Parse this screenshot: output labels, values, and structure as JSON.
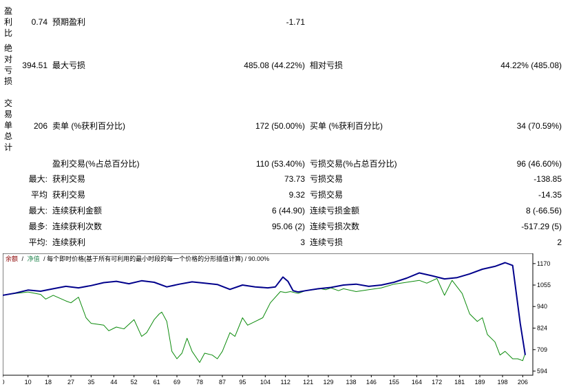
{
  "stats": {
    "row1": {
      "label": "盈利比",
      "value": "0.74",
      "c1_label": "预期盈利",
      "c1_value": "-1.71"
    },
    "row2": {
      "label": "绝对亏损",
      "value": "394.51",
      "c1_label": "最大亏损",
      "c1_value": "485.08 (44.22%)",
      "c2_label": "相对亏损",
      "c2_value": "44.22% (485.08)"
    },
    "row3": {
      "label": "交易单总计",
      "value": "206",
      "c1_label": "卖单 (%获利百分比)",
      "c1_value": "172 (50.00%)",
      "c2_label": "买单 (%获利百分比)",
      "c2_value": "34 (70.59%)"
    },
    "row4": {
      "c1_label": "盈利交易(%占总百分比)",
      "c1_value": "110 (53.40%)",
      "c2_label": "亏损交易(%占总百分比)",
      "c2_value": "96 (46.60%)"
    },
    "row5": {
      "prefix": "最大:",
      "c1_label": "获利交易",
      "c1_value": "73.73",
      "c2_label": "亏损交易",
      "c2_value": "-138.85"
    },
    "row6": {
      "prefix": "平均",
      "c1_label": "获利交易",
      "c1_value": "9.32",
      "c2_label": "亏损交易",
      "c2_value": "-14.35"
    },
    "row7": {
      "prefix": "最大:",
      "c1_label": "连续获利金额",
      "c1_value": "6 (44.90)",
      "c2_label": "连续亏损金额",
      "c2_value": "8 (-66.56)"
    },
    "row8": {
      "prefix": "最多:",
      "c1_label": "连续获利次数",
      "c1_value": "95.06 (2)",
      "c2_label": "连续亏损次数",
      "c2_value": "-517.29 (5)"
    },
    "row9": {
      "prefix": "平均:",
      "c1_label": "连续获利",
      "c1_value": "3",
      "c2_label": "连续亏损",
      "c2_value": "2"
    }
  },
  "chart_legend": {
    "balance": "余额",
    "sep1": "/",
    "equity": "净值",
    "rest": "/ 每个即时价格(基于所有可利用的最小时段的每一个价格的分形插值计算) / 90.00%"
  },
  "colors": {
    "balance": "#00008b",
    "equity": "#0a8a0a",
    "legend_balance": "#8b0000",
    "legend_equity": "#2e8b57"
  },
  "chart_data": {
    "type": "line",
    "x_ticks": [
      "0",
      "10",
      "18",
      "27",
      "35",
      "44",
      "52",
      "61",
      "69",
      "78",
      "87",
      "95",
      "104",
      "112",
      "121",
      "129",
      "138",
      "146",
      "155",
      "164",
      "172",
      "181",
      "189",
      "198",
      "206"
    ],
    "y_ticks": [
      "1170",
      "1055",
      "940",
      "824",
      "709",
      "594"
    ],
    "ylim": [
      594,
      1210
    ],
    "xlim": [
      0,
      210
    ],
    "series": [
      {
        "key": "balance",
        "x": [
          0,
          5,
          10,
          15,
          20,
          25,
          30,
          35,
          40,
          45,
          50,
          55,
          60,
          65,
          70,
          75,
          80,
          85,
          90,
          95,
          100,
          105,
          108,
          111,
          113,
          115,
          117,
          120,
          125,
          130,
          135,
          140,
          145,
          150,
          155,
          160,
          165,
          170,
          175,
          180,
          185,
          190,
          195,
          199,
          202,
          205,
          207
        ],
        "y": [
          1000,
          1012,
          1028,
          1022,
          1035,
          1048,
          1040,
          1052,
          1068,
          1075,
          1062,
          1078,
          1070,
          1045,
          1060,
          1072,
          1065,
          1058,
          1032,
          1055,
          1045,
          1040,
          1045,
          1098,
          1075,
          1025,
          1018,
          1025,
          1035,
          1042,
          1055,
          1060,
          1048,
          1055,
          1070,
          1092,
          1120,
          1105,
          1088,
          1095,
          1115,
          1140,
          1155,
          1175,
          1160,
          850,
          680
        ]
      },
      {
        "key": "equity",
        "x": [
          0,
          5,
          10,
          15,
          17,
          20,
          25,
          27,
          30,
          33,
          35,
          40,
          42,
          45,
          48,
          52,
          55,
          57,
          60,
          62,
          63,
          65,
          67,
          69,
          71,
          73,
          75,
          78,
          80,
          83,
          85,
          87,
          90,
          92,
          95,
          97,
          100,
          103,
          106,
          110,
          112,
          114,
          117,
          120,
          123,
          126,
          128,
          130,
          133,
          135,
          140,
          145,
          150,
          155,
          160,
          165,
          168,
          172,
          175,
          178,
          182,
          185,
          188,
          190,
          192,
          195,
          197,
          199,
          202,
          204,
          206,
          207
        ],
        "y": [
          1000,
          1010,
          1018,
          1005,
          980,
          1000,
          970,
          960,
          990,
          880,
          850,
          840,
          810,
          830,
          820,
          870,
          780,
          800,
          870,
          900,
          910,
          860,
          700,
          660,
          690,
          770,
          700,
          640,
          690,
          680,
          660,
          700,
          800,
          780,
          880,
          840,
          860,
          880,
          960,
          1020,
          1015,
          1020,
          1010,
          1025,
          1030,
          1035,
          1030,
          1040,
          1025,
          1035,
          1020,
          1030,
          1040,
          1060,
          1070,
          1080,
          1065,
          1090,
          1000,
          1080,
          1010,
          900,
          860,
          880,
          790,
          750,
          680,
          700,
          660,
          660,
          650,
          690
        ]
      }
    ]
  }
}
